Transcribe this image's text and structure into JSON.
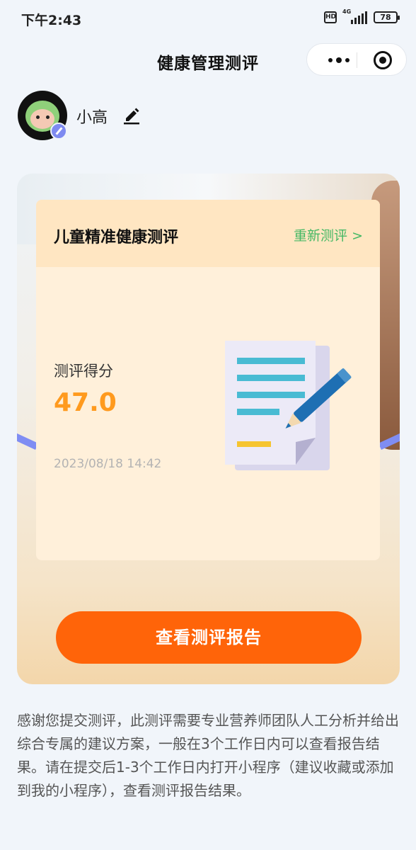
{
  "status_bar": {
    "time": "下午2:43",
    "hd": "HD",
    "network": "4G",
    "battery": "78"
  },
  "nav": {
    "title": "健康管理测评"
  },
  "user": {
    "name": "小高"
  },
  "assessment": {
    "title": "儿童精准健康测评",
    "redo_label": "重新测评 >",
    "score_label": "测评得分",
    "score": "47.0",
    "date": "2023/08/18 14:42",
    "accent_color": "#ff9a1e",
    "link_color": "#44b864"
  },
  "actions": {
    "view_report_label": "查看测评报告",
    "button_color": "#ff6409"
  },
  "notice": "感谢您提交测评，此测评需要专业营养师团队人工分析并给出综合专属的建议方案，一般在3个工作日内可以查看报告结果。请在提交后1-3个工作日内打开小程序（建议收藏或添加到我的小程序），查看测评报告结果。",
  "icons": [
    "hd-icon",
    "signal-icon",
    "battery-icon",
    "more-icon",
    "close-capsule-icon",
    "avatar",
    "edit-avatar-icon",
    "edit-name-icon",
    "document-pen-icon"
  ]
}
